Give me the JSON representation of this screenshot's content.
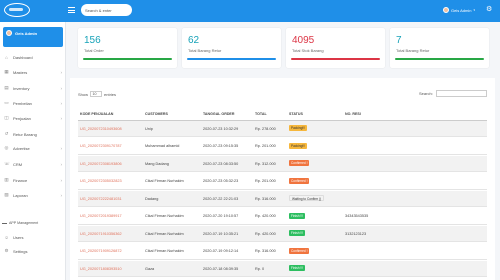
{
  "topbar": {
    "search_placeholder": "Search & enter",
    "user_name": "Geis Admin",
    "caret": "▾",
    "settings_icon": "⚙"
  },
  "sidebar": {
    "user_name": "Geis Admin",
    "items": [
      {
        "label": "Dashboard",
        "icon": "⌂",
        "chevron": ""
      },
      {
        "label": "Masters",
        "icon": "▦",
        "chevron": "›"
      },
      {
        "label": "Inventory",
        "icon": "▤",
        "chevron": "›"
      },
      {
        "label": "Pembelian",
        "icon": "▭",
        "chevron": "›"
      },
      {
        "label": "Penjualan",
        "icon": "◫",
        "chevron": "›"
      },
      {
        "label": "Retur Barang",
        "icon": "↺",
        "chevron": ""
      },
      {
        "label": "Advertise",
        "icon": "◎",
        "chevron": "›"
      },
      {
        "label": "CRM",
        "icon": "☏",
        "chevron": "›"
      },
      {
        "label": "Finance",
        "icon": "▥",
        "chevron": "›"
      },
      {
        "label": "Laporan",
        "icon": "▧",
        "chevron": "›"
      }
    ],
    "section_label": "APP Management",
    "bottom_items": [
      {
        "label": "Users",
        "icon": "☺"
      },
      {
        "label": "Settings",
        "icon": "⚙"
      }
    ]
  },
  "stats": [
    {
      "value": "156",
      "label": "Total Order",
      "color": "#17a2b8",
      "bar_color": "#28a745"
    },
    {
      "value": "62",
      "label": "Total Barang Retur",
      "color": "#17a2b8",
      "bar_color": "#1f8fe8"
    },
    {
      "value": "4095",
      "label": "Total Stok Barang",
      "color": "#dc3545",
      "bar_color": "#dc3545"
    },
    {
      "value": "7",
      "label": "Total Barang Retur",
      "color": "#17a2b8",
      "bar_color": "#28a745"
    }
  ],
  "table": {
    "show_label": "Show",
    "entries_value": "10",
    "entries_label": "entries",
    "search_label": "Search:",
    "columns": [
      "KODE PENJUALAN",
      "CUSTOMERS",
      "TANGGAL ORDER",
      "TOTAL",
      "STATUS",
      "NO. RESI"
    ],
    "rows": [
      {
        "kode": "UG_2020072310493608",
        "customer": "Unip",
        "tanggal": "2020-07-23 10:32:29",
        "total": "Rp. 278.000",
        "status": "Packing!!!",
        "status_type": "paid",
        "resi": ""
      },
      {
        "kode": "UG_2020072309170787",
        "customer": "Muhammad alhamid",
        "tanggal": "2020-07-23 09:15:35",
        "total": "Rp. 201.000",
        "status": "Packing!!!",
        "status_type": "paid",
        "resi": ""
      },
      {
        "kode": "UG_2020072308193806",
        "customer": "Mang Dadang",
        "tanggal": "2020-07-23 08:33:50",
        "total": "Rp. 312.000",
        "status": "Confirmed !",
        "status_type": "conf",
        "resi": ""
      },
      {
        "kode": "UG_2020072305032823",
        "customer": "Cikal Firman Nurhakim",
        "tanggal": "2020-07-23 05:32:23",
        "total": "Rp. 201.000",
        "status": "Confirmed !",
        "status_type": "conf",
        "resi": ""
      },
      {
        "kode": "UG_2020072222481031",
        "customer": "Dadang",
        "tanggal": "2020-07-22 22:21:03",
        "total": "Rp. 316.000",
        "status": "Waiting to Confirm ()",
        "status_type": "wait",
        "resi": ""
      },
      {
        "kode": "UG_2020072019389917",
        "customer": "Cikal Firman Nurhakim",
        "tanggal": "2020-07-20 19:10:57",
        "total": "Rp. 420.000",
        "status": "Finish !!!",
        "status_type": "fin",
        "resi": "34343543535"
      },
      {
        "kode": "UG_2020071910356362",
        "customer": "Cikal Firman Nurhakim",
        "tanggal": "2020-07-19 10:35:21",
        "total": "Rp. 420.000",
        "status": "Finish !!!",
        "status_type": "fin",
        "resi": "3132123123"
      },
      {
        "kode": "UG_2020071909126872",
        "customer": "Cikal Firman Nurhakim",
        "tanggal": "2020-07-19 09:12:14",
        "total": "Rp. 316.000",
        "status": "Confirmed !",
        "status_type": "conf",
        "resi": ""
      },
      {
        "kode": "UG_2020071808393510",
        "customer": "Gaza",
        "tanggal": "2020-07-18 08:39:35",
        "total": "Rp. 0",
        "status": "Finish !!!",
        "status_type": "fin",
        "resi": ""
      }
    ]
  }
}
